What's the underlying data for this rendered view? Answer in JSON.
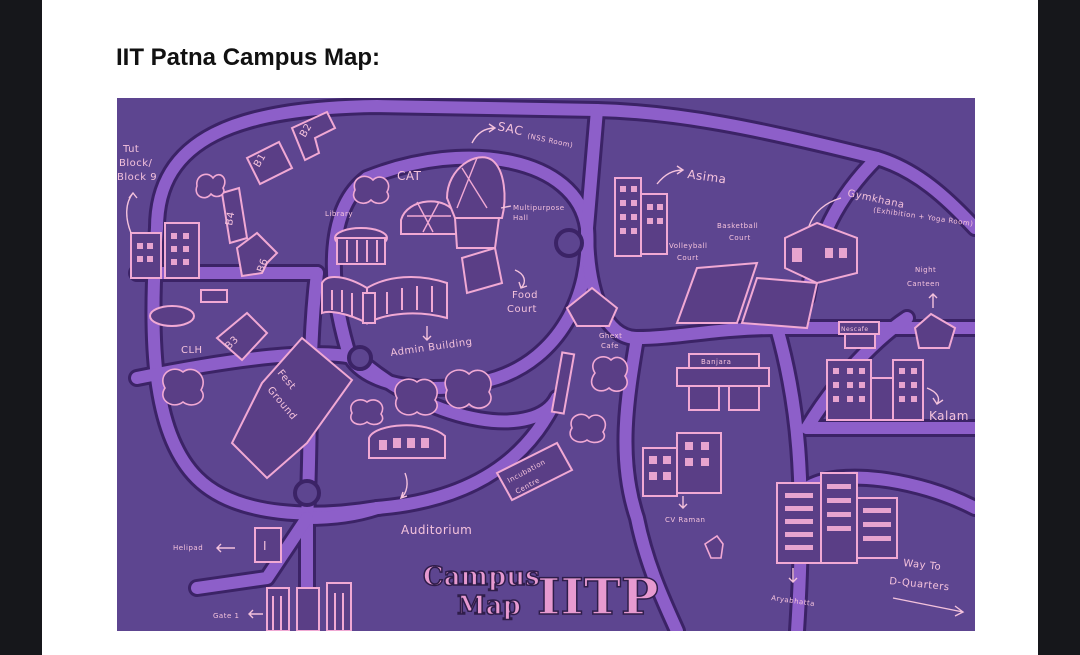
{
  "document": {
    "title": "IIT Patna Campus Map:"
  },
  "map": {
    "colors": {
      "land": "#5d4590",
      "road": "#8d5fc9",
      "road_edge": "#3b2366",
      "ink": "#f1a9d4",
      "logo": "#e79ad0"
    },
    "labels": {
      "tut_block": [
        "Tut",
        "Block/",
        "Block 9"
      ],
      "b1": "B1",
      "b2": "B2",
      "b4": "B4",
      "b6": "B6",
      "cat": "CAT",
      "library": "Library",
      "sac": "SAC",
      "sac_note": "(NSS Room)",
      "multipurpose": [
        "Multipurpose",
        "Hall"
      ],
      "asima": "Asima",
      "gymkhana": "Gymkhana",
      "gymkhana_note": "(Exhibition + Yoga Room)",
      "basketball": [
        "Basketball",
        "Court"
      ],
      "volleyball": [
        "Volleyball",
        "Court"
      ],
      "night_canteen": [
        "Night",
        "Canteen"
      ],
      "food_court": [
        "Food",
        "Court"
      ],
      "ghext": [
        "Ghext",
        "Cafe"
      ],
      "admin": "Admin Building",
      "clh": "CLH",
      "b3": "B3",
      "fest_ground": [
        "Fest",
        "Ground"
      ],
      "banjara": "Banjara",
      "nescafe": "Nescafe",
      "kalam": "Kalam",
      "incubation": [
        "Incubation",
        "Centre"
      ],
      "auditorium": "Auditorium",
      "cv_raman": "CV Raman",
      "helipad": "Helipad",
      "helipad_mark": "I",
      "gate1": "Gate 1",
      "aryabhatta": "Aryabhatta",
      "way_to": [
        "Way To",
        "D-Quarters"
      ],
      "logo_line1": "Campus",
      "logo_line2": "Map",
      "logo_iitp": "IITP"
    }
  }
}
